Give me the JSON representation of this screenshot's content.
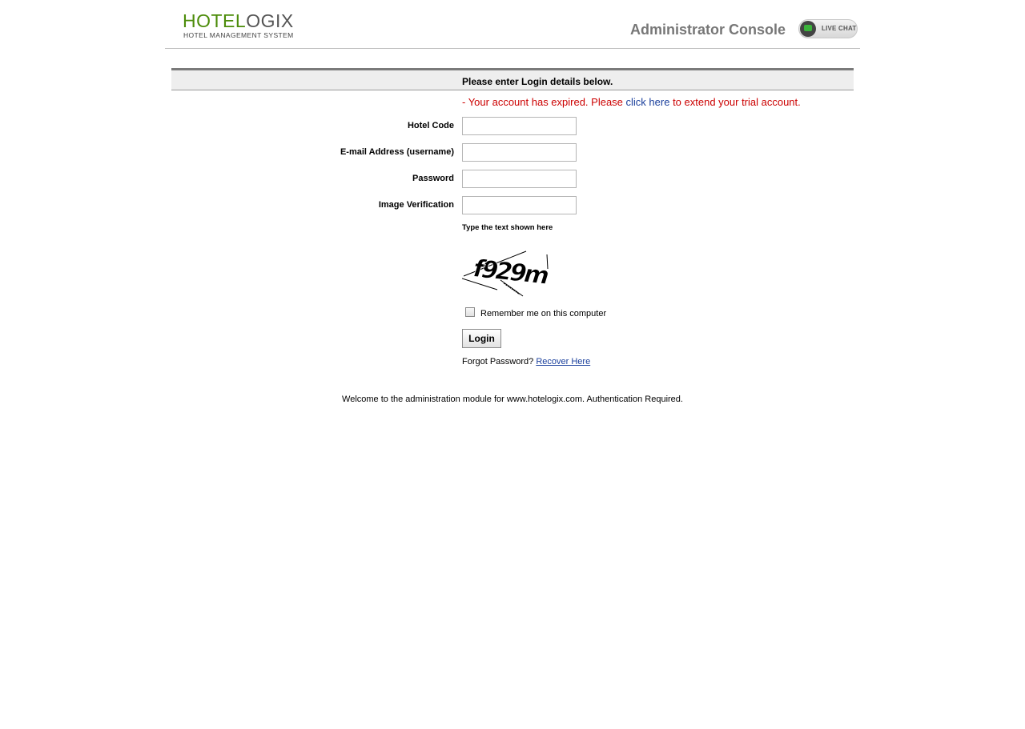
{
  "header": {
    "logo_part1": "HOTEL",
    "logo_part2": "OGIX",
    "logo_subtitle": "HOTEL MANAGEMENT SYSTEM",
    "console_title": "Administrator Console",
    "live_chat_label": "LIVE CHAT"
  },
  "login": {
    "section_title": "Please enter Login details below.",
    "error_prefix": "- Your account has expired. Please ",
    "error_link": "click here",
    "error_suffix": " to extend your trial account.",
    "fields": {
      "hotel_code_label": "Hotel Code",
      "hotel_code_value": "",
      "email_label": "E-mail Address (username)",
      "email_value": "",
      "password_label": "Password",
      "password_value": "",
      "image_verification_label": "Image Verification",
      "image_verification_value": ""
    },
    "captcha_instruction": "Type the text shown here",
    "captcha_text": "f929m",
    "remember_label": "Remember me on this computer",
    "remember_checked": false,
    "login_button": "Login",
    "forgot_text": "Forgot Password? ",
    "recover_link": "Recover Here"
  },
  "footer": {
    "text": "Welcome to the administration module for www.hotelogix.com. Authentication Required."
  },
  "colors": {
    "brand_green": "#4c8c0a",
    "error_red": "#cc0000",
    "link_blue": "#1a3f9c",
    "chat_green": "#3bb33b"
  }
}
